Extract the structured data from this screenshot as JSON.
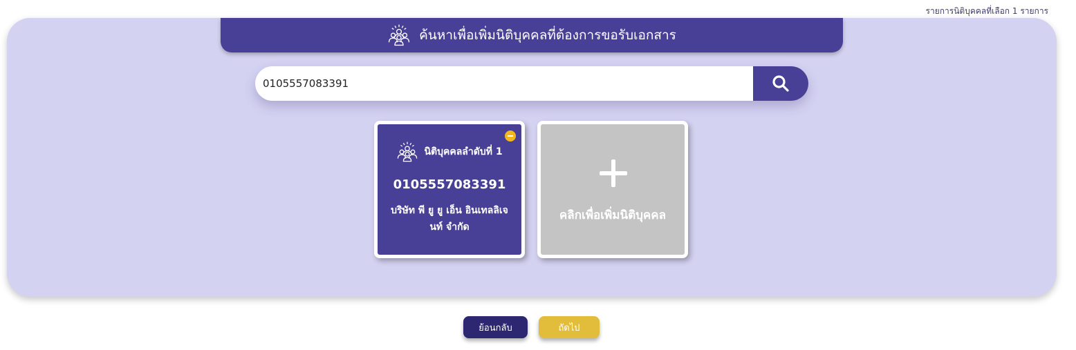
{
  "selection_counter": "รายการนิติบุคคลที่เลือก 1 รายการ",
  "header": {
    "title": "ค้นหาเพื่อเพิ่มนิติบุคคลที่ต้องการขอรับเอกสาร",
    "icon": "people-group-icon"
  },
  "search": {
    "value": "0105557083391",
    "placeholder": "",
    "button_icon": "search-icon"
  },
  "entities": [
    {
      "heading": "นิติบุคคลลำดับที่ 1",
      "registration_number": "0105557083391",
      "name": "บริษัท พี ยู ยู เอ็น อินเทลลิเจนท์ จำกัด",
      "icon": "people-group-icon",
      "remove_icon": "minus-circle-icon"
    }
  ],
  "add_card": {
    "label": "คลิกเพื่อเพิ่มนิติบุคคล",
    "icon": "plus-icon"
  },
  "buttons": {
    "back": "ย้อนกลับ",
    "next": "ถัดไป"
  },
  "colors": {
    "primary": "#484096",
    "panel": "#d4d2f1",
    "add_card": "#c4c4c4",
    "back_button": "#2d2670",
    "next_button": "#e2bd3c",
    "badge": "#f2b81a"
  }
}
